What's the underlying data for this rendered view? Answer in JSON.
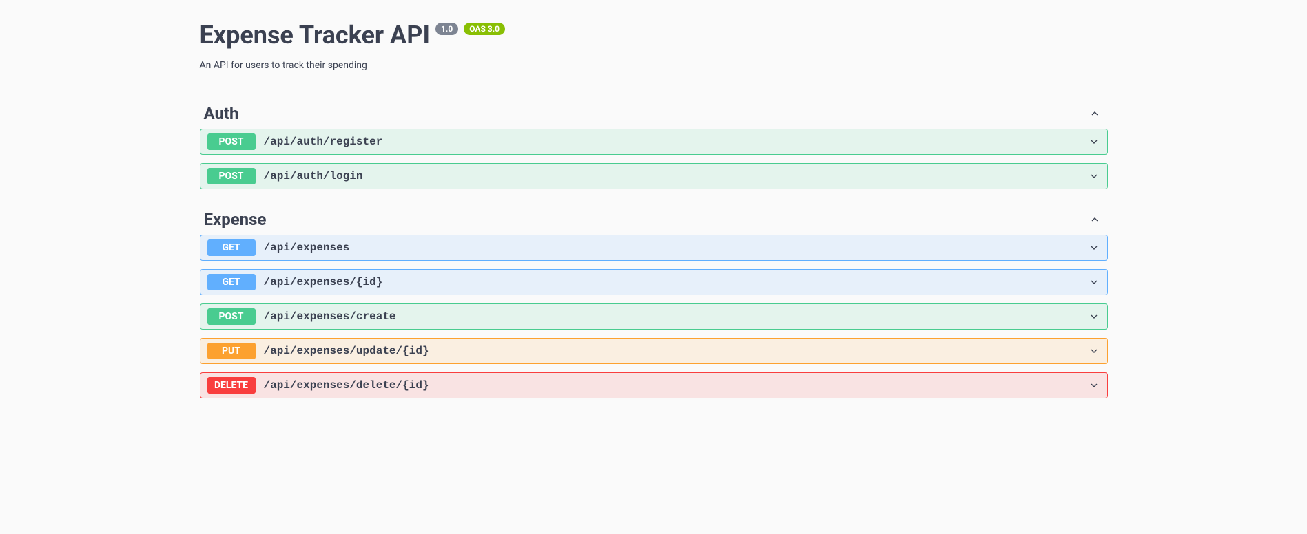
{
  "header": {
    "title": "Expense Tracker API",
    "version_badge": "1.0",
    "oas_badge": "OAS 3.0",
    "description": "An API for users to track their spending"
  },
  "tags": [
    {
      "name": "Auth",
      "expanded": true,
      "operations": [
        {
          "method": "POST",
          "path": "/api/auth/register"
        },
        {
          "method": "POST",
          "path": "/api/auth/login"
        }
      ]
    },
    {
      "name": "Expense",
      "expanded": true,
      "operations": [
        {
          "method": "GET",
          "path": "/api/expenses"
        },
        {
          "method": "GET",
          "path": "/api/expenses/{id}"
        },
        {
          "method": "POST",
          "path": "/api/expenses/create"
        },
        {
          "method": "PUT",
          "path": "/api/expenses/update/{id}"
        },
        {
          "method": "DELETE",
          "path": "/api/expenses/delete/{id}"
        }
      ]
    }
  ]
}
